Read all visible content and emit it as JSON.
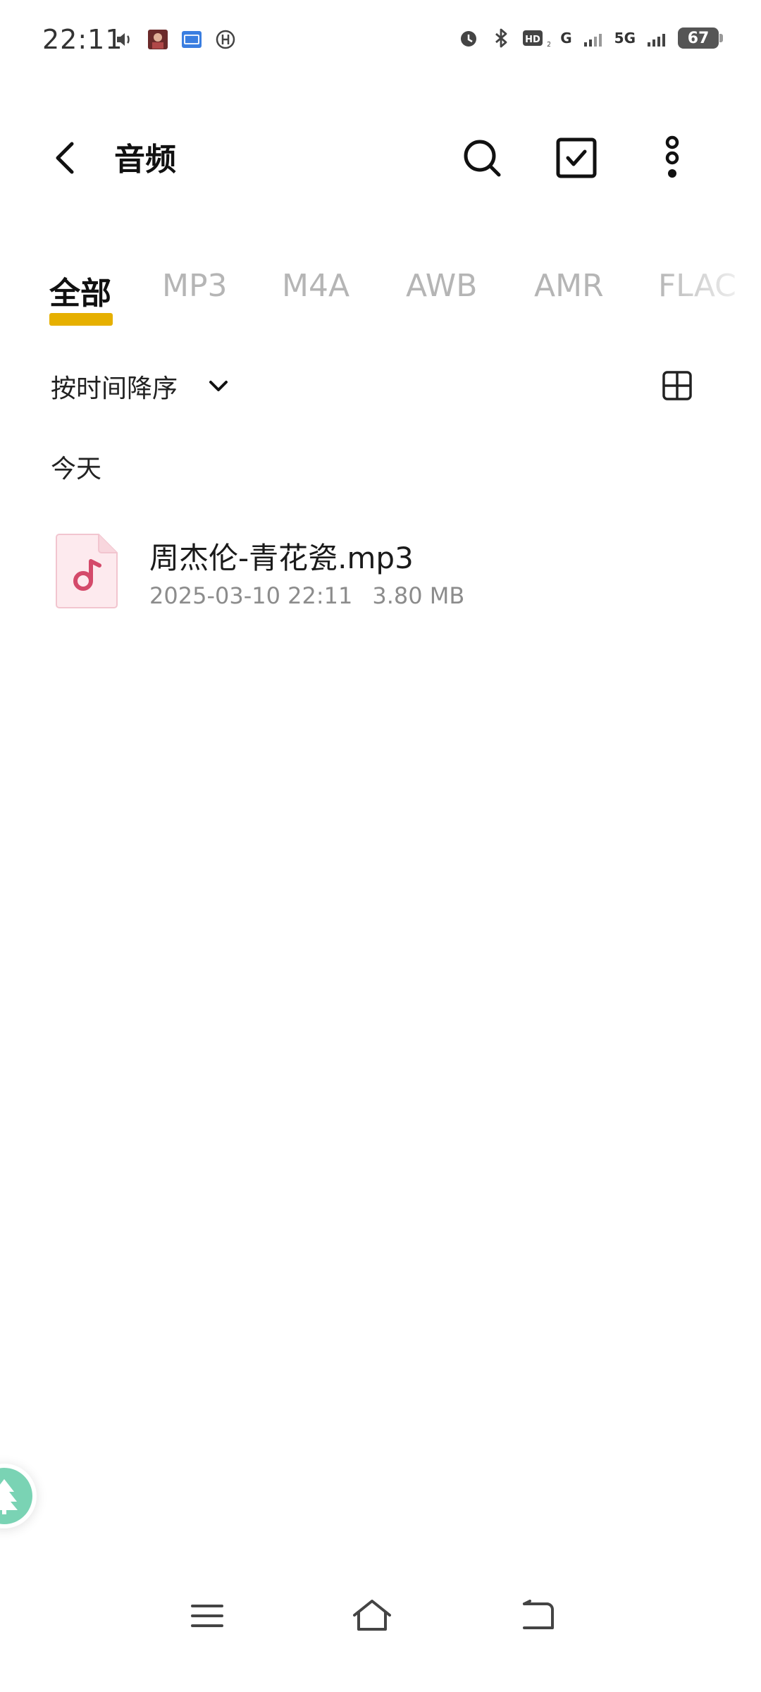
{
  "status_bar": {
    "time": "22:11",
    "network_5g": "5G",
    "network_g": "G",
    "hd": "HD",
    "battery": "67"
  },
  "header": {
    "title": "音频",
    "icons": {
      "back": "back-arrow-icon",
      "search": "search-icon",
      "select": "checkbox-icon",
      "more": "more-vertical-icon"
    }
  },
  "tabs": [
    {
      "label": "全部",
      "active": true
    },
    {
      "label": "MP3",
      "active": false
    },
    {
      "label": "M4A",
      "active": false
    },
    {
      "label": "AWB",
      "active": false
    },
    {
      "label": "AMR",
      "active": false
    },
    {
      "label": "FLAC",
      "active": false
    }
  ],
  "sort": {
    "label": "按时间降序",
    "view_icon": "grid-view-icon"
  },
  "sections": [
    {
      "title": "今天",
      "files": [
        {
          "name": "周杰伦-青花瓷.mp3",
          "date": "2025-03-10 22:11",
          "size": "3.80 MB",
          "icon": "music-file-icon"
        }
      ]
    }
  ],
  "colors": {
    "accent": "#e6b000",
    "file_icon_bg": "#fdeaee",
    "file_icon_fg": "#d44a6a",
    "inactive_tab": "#b5b5b5",
    "meta_text": "#8c8c8c"
  },
  "nav": {
    "menu": "menu-icon",
    "home": "home-icon",
    "back": "back-icon"
  }
}
